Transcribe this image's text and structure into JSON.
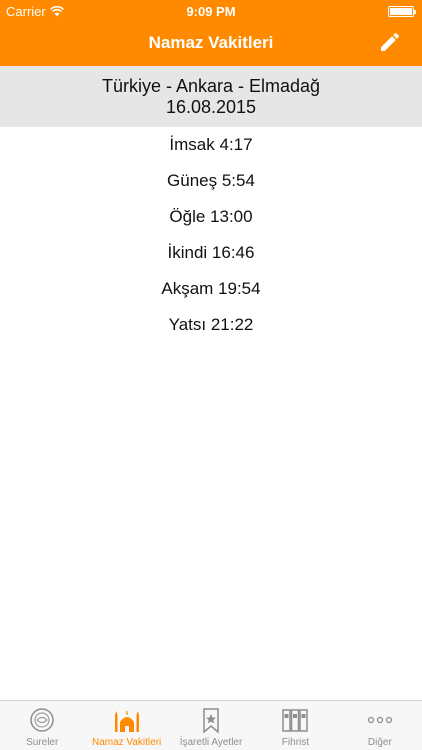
{
  "status_bar": {
    "carrier": "Carrier",
    "time": "9:09 PM"
  },
  "nav": {
    "title": "Namaz Vakitleri",
    "edit_icon": "pencil-icon"
  },
  "location": {
    "place": "Türkiye - Ankara - Elmadağ",
    "date": "16.08.2015"
  },
  "prayer_times": [
    {
      "text": "İmsak 4:17"
    },
    {
      "text": "Güneş 5:54"
    },
    {
      "text": "Öğle 13:00"
    },
    {
      "text": "İkindi 16:46"
    },
    {
      "text": "Akşam 19:54"
    },
    {
      "text": "Yatsı 21:22"
    }
  ],
  "tabbar": {
    "tabs": [
      {
        "label": "Sureler",
        "icon": "quran-icon"
      },
      {
        "label": "Namaz Vakitleri",
        "icon": "mosque-icon",
        "active": true
      },
      {
        "label": "İşaretli Ayetler",
        "icon": "bookmark-icon"
      },
      {
        "label": "Fihrist",
        "icon": "binders-icon"
      },
      {
        "label": "Diğer",
        "icon": "more-icon"
      }
    ]
  },
  "colors": {
    "accent": "#FF8A00",
    "header_band": "#E6E6E6",
    "inactive_tab": "#8E8E8E"
  }
}
